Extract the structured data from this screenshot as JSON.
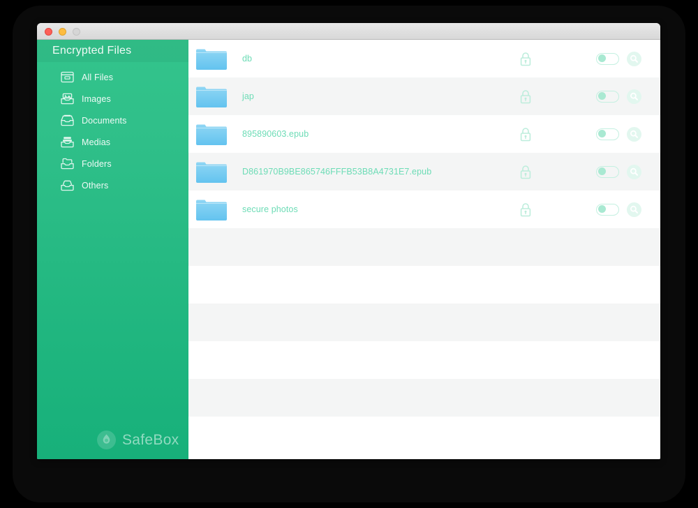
{
  "window": {
    "traffic_lights": [
      {
        "name": "close",
        "color": "#fc6058"
      },
      {
        "name": "minimize",
        "color": "#fdbc40"
      },
      {
        "name": "zoom",
        "color": "#d6d6d6"
      }
    ]
  },
  "sidebar": {
    "header_title": "Encrypted Files",
    "items": [
      {
        "label": "All Files",
        "icon": "tray-all-files-icon"
      },
      {
        "label": "Images",
        "icon": "tray-images-icon"
      },
      {
        "label": "Documents",
        "icon": "tray-documents-icon"
      },
      {
        "label": "Medias",
        "icon": "tray-medias-icon"
      },
      {
        "label": "Folders",
        "icon": "tray-folders-icon"
      },
      {
        "label": "Others",
        "icon": "tray-others-icon"
      }
    ],
    "brand": {
      "name": "SafeBox",
      "mark": "safebox-logo-icon"
    },
    "colors": {
      "gradient_top": "#33c48c",
      "gradient_bottom": "#17b07a",
      "header_overlay": "rgba(0,0,0,0.045)"
    }
  },
  "file_list": {
    "row_icon": "blue-folder-icon",
    "lock_icon": "padlock-icon",
    "search_icon": "search-icon",
    "toggle_state": "off",
    "accent_text_color": "#6ddcb6",
    "accent_toggle_color": "#c4f0e1",
    "stripe_color": "#f4f5f5",
    "rows": [
      {
        "name": "db",
        "locked": true,
        "enabled": false
      },
      {
        "name": "jap",
        "locked": true,
        "enabled": false
      },
      {
        "name": "895890603.epub",
        "locked": true,
        "enabled": false
      },
      {
        "name": "D861970B9BE865746FFFB53B8A4731E7.epub",
        "locked": true,
        "enabled": false
      },
      {
        "name": "secure photos",
        "locked": true,
        "enabled": false
      }
    ],
    "empty_row_count": 6
  }
}
